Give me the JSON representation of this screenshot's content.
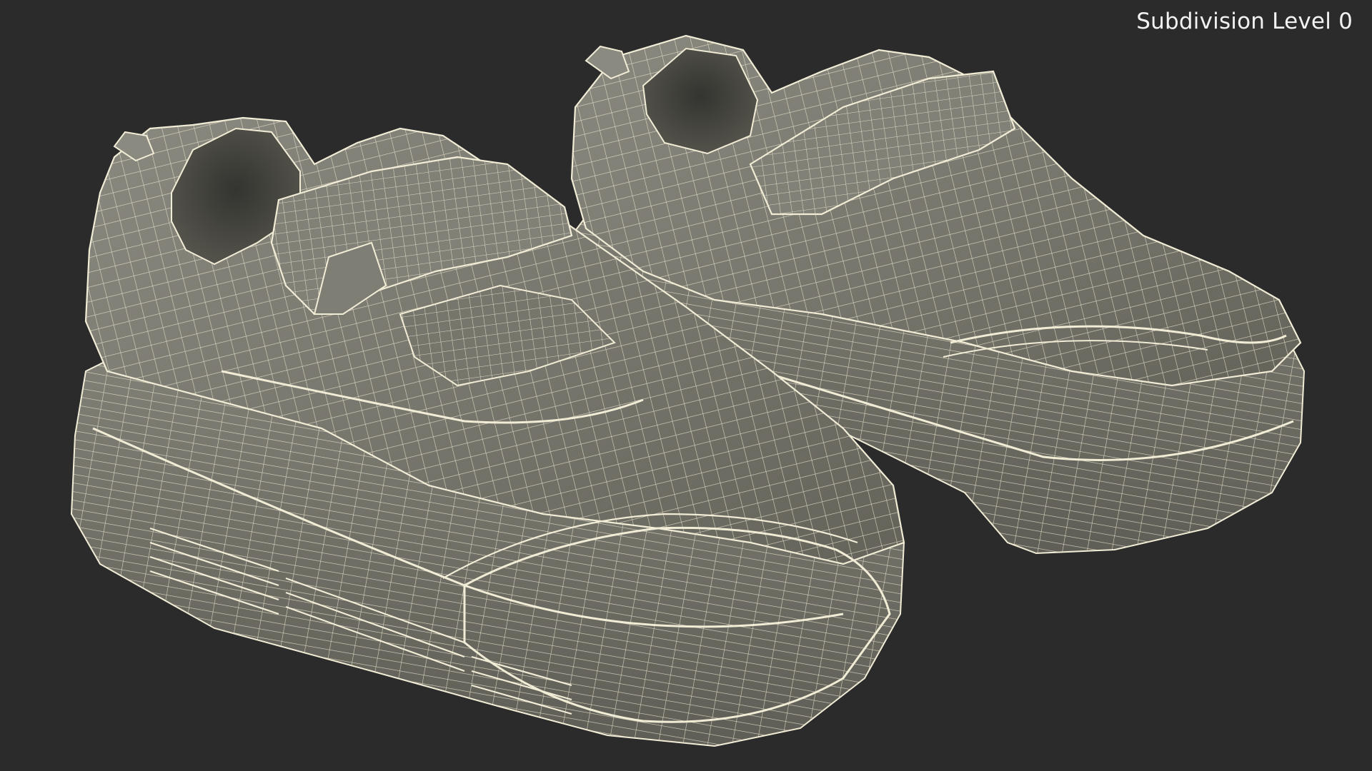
{
  "viewport": {
    "label": "Subdivision Level 0",
    "background_color": "#2b2b2b"
  },
  "scene": {
    "subject": "pair of sneakers wireframe render",
    "mesh_fill_color": "#7b7a70",
    "wire_color": "#f1ecd6"
  }
}
